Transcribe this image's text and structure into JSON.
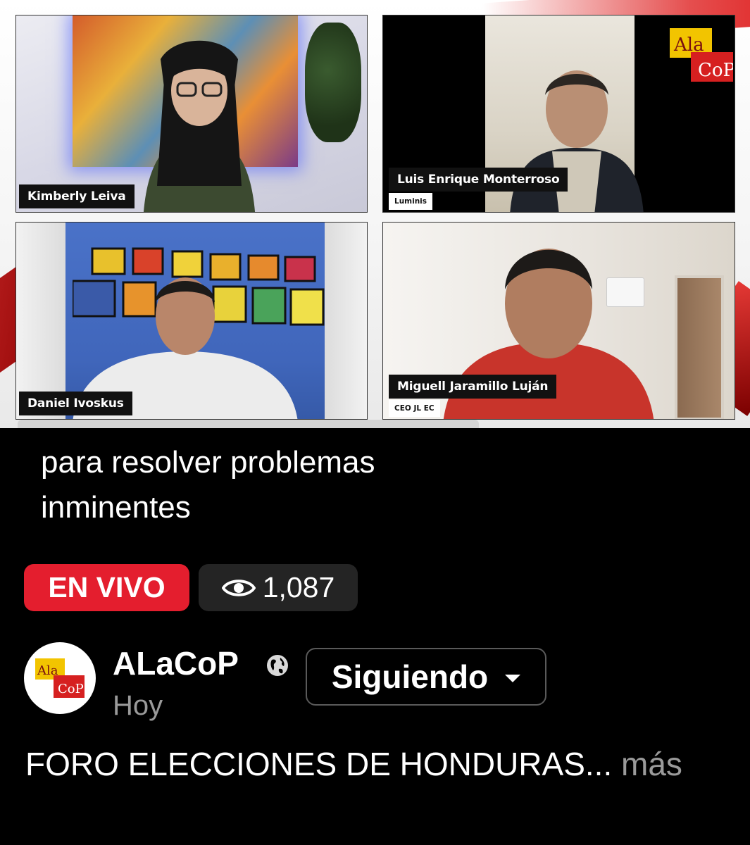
{
  "video": {
    "participants": [
      {
        "name": "Kimberly Leiva",
        "org": ""
      },
      {
        "name": "Luis Enrique Monterroso",
        "org": "Luminis"
      },
      {
        "name": "Daniel Ivoskus",
        "org": ""
      },
      {
        "name": "Miguell Jaramillo Luján",
        "org": "CEO JL EC"
      }
    ],
    "logo_text": {
      "line1": "Ala",
      "line2": "CoP"
    }
  },
  "caption": {
    "line1": "para resolver problemas",
    "line2": "inminentes"
  },
  "live_badge": "EN VIVO",
  "viewer_count": "1,087",
  "page": {
    "name": "ALaCoP",
    "time": "Hoy",
    "follow_label": "Siguiendo",
    "description": "FORO ELECCIONES DE HONDURAS...",
    "more_label": "más"
  },
  "colors": {
    "live_red": "#e41e2e",
    "badge_dark": "#242424",
    "muted_text": "#9a9a9a",
    "logo_yellow": "#f2c400",
    "logo_red": "#d62020"
  },
  "icons": {
    "viewers": "eye-icon",
    "privacy": "globe-icon",
    "follow_menu": "caret-down-icon"
  }
}
